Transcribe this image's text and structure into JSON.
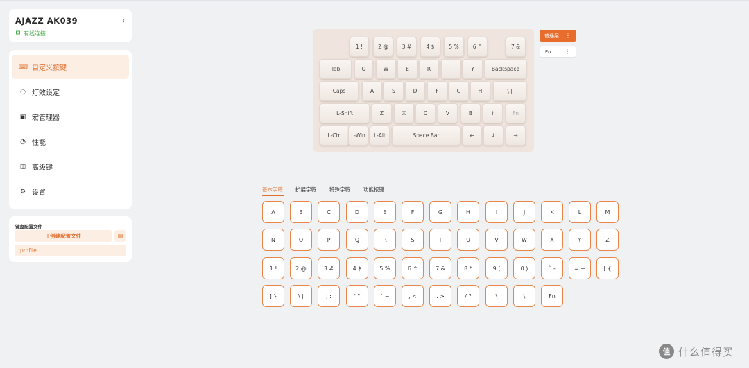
{
  "device": {
    "name": "AJAZZ AK039",
    "connection": "有线连接",
    "collapse_glyph": "‹"
  },
  "menu": {
    "items": [
      {
        "label": "自定义按键",
        "icon": "keyboard-icon",
        "glyph": "⌨"
      },
      {
        "label": "灯效设定",
        "icon": "bulb-icon",
        "glyph": "◌"
      },
      {
        "label": "宏管理器",
        "icon": "macro-icon",
        "glyph": "▣"
      },
      {
        "label": "性能",
        "icon": "gauge-icon",
        "glyph": "◔"
      },
      {
        "label": "高级键",
        "icon": "advanced-key-icon",
        "glyph": "◫"
      },
      {
        "label": "设置",
        "icon": "gear-icon",
        "glyph": "⚙"
      }
    ]
  },
  "profiles": {
    "title": "键盘配置文件",
    "create_label": "+创建配置文件",
    "file_icon_glyph": "▤",
    "items": [
      "profile"
    ]
  },
  "keyboard": {
    "rows": [
      [
        "1 !",
        "2 @",
        "3 #",
        "4 $",
        "5 %",
        "6 ^",
        "7 &"
      ],
      [
        "Tab",
        "Q",
        "W",
        "E",
        "R",
        "T",
        "Y",
        "Backspace"
      ],
      [
        "Caps",
        "A",
        "S",
        "D",
        "F",
        "G",
        "H",
        "\\ |"
      ],
      [
        "L-Shift",
        "Z",
        "X",
        "C",
        "V",
        "B",
        "↑",
        "Fn"
      ],
      [
        "L-Ctrl",
        "L-Win",
        "L-Alt",
        "Space Bar",
        "←",
        "↓",
        "→"
      ]
    ]
  },
  "layers": {
    "items": [
      {
        "label": "普通层",
        "active": true
      },
      {
        "label": "Fn",
        "active": false
      }
    ],
    "more_glyph": "⋮"
  },
  "tabs": {
    "items": [
      "基本字符",
      "扩展字符",
      "特殊字符",
      "功能按键"
    ],
    "active_index": 0
  },
  "chars": {
    "rows": [
      [
        "A",
        "B",
        "C",
        "D",
        "E",
        "F",
        "G",
        "H",
        "I",
        "J",
        "K",
        "L",
        "M"
      ],
      [
        "N",
        "O",
        "P",
        "Q",
        "R",
        "S",
        "T",
        "U",
        "V",
        "W",
        "X",
        "Y",
        "Z"
      ],
      [
        "1 !",
        "2 @",
        "3 #",
        "4 $",
        "5 %",
        "6 ^",
        "7 &",
        "8 *",
        "9 (",
        "0 )",
        "` -",
        "= +",
        "[ {"
      ],
      [
        "] }",
        "\\ |",
        "; :",
        "' \"",
        "` ~",
        ", <",
        ". >",
        "/ ?",
        "\\",
        "\\",
        "Fn"
      ]
    ]
  },
  "watermark": {
    "logo": "值",
    "text": "什么值得买"
  },
  "colors": {
    "accent": "#e86c2c",
    "accent_light": "#fdeee3",
    "connected": "#4caf50",
    "keyboard_plate": "#efe5de"
  }
}
